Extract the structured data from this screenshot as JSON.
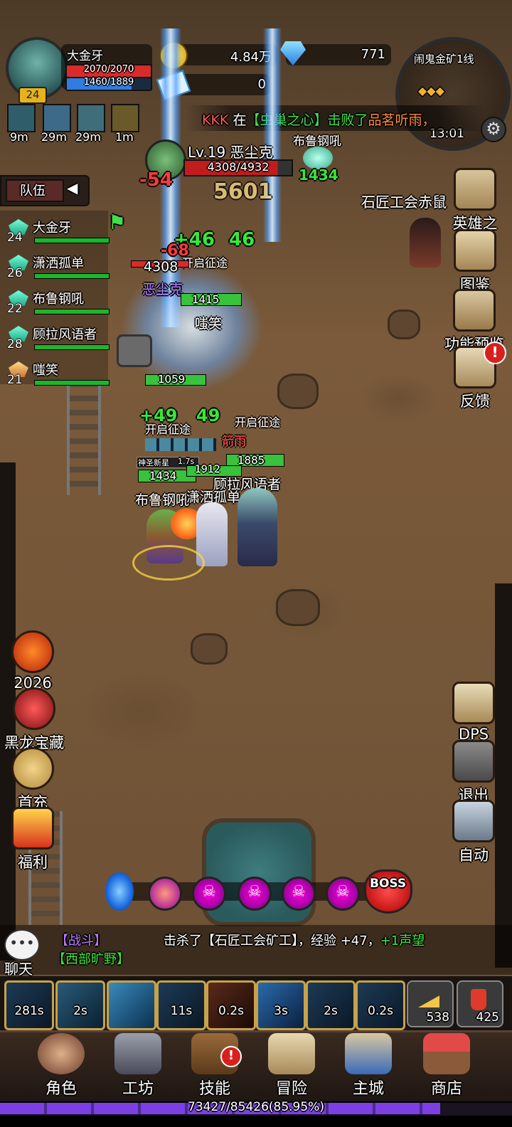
{
  "player": {
    "name": "大金牙",
    "level": "24",
    "hp": "2070/2070",
    "mp": "1460/1889",
    "hp_frac": 1.0,
    "mp_frac": 0.773
  },
  "buffs": [
    "9m",
    "29m",
    "29m",
    "1m"
  ],
  "currency": {
    "gold": "4.84万",
    "diamond": "771",
    "ticket": "0"
  },
  "minimap": {
    "title": "闹鬼金矿1线",
    "time": "13:01"
  },
  "broadcast": {
    "player": "KKK",
    "at": "在",
    "place": "【虫巢之心】",
    "action": "击败了",
    "target": "品茗听雨，"
  },
  "team_label": "队伍",
  "party": [
    {
      "level": "24",
      "name": "大金牙"
    },
    {
      "level": "26",
      "name": "潇洒孤单"
    },
    {
      "level": "22",
      "name": "布鲁钢吼"
    },
    {
      "level": "28",
      "name": "顾拉风语者"
    },
    {
      "level": "21",
      "name": "嗤笑"
    }
  ],
  "boss_target": {
    "label": "Lv.19 恶尘克",
    "hp": "4308/4932",
    "hp_frac": 0.873
  },
  "battle_labels": {
    "ally_top": "布鲁钢吼",
    "ally_top_hp": "1434",
    "guild_enemy": "石匠工会赤鼠",
    "enemy_name": "恶尘克",
    "enemy_hp_text": "4308",
    "chixiao": "嗤笑",
    "chixiao_hp": "1415",
    "hp_1059": "1059",
    "journey": "开启征途",
    "journey2": "开启征途",
    "journey3": "开启征途",
    "rain": "箭雨",
    "holy_star": "神圣新星",
    "holy_time": "1.7s",
    "hp_1885": "1885",
    "hp_1434": "1434",
    "hp_1912": "1912",
    "name_bulu": "布鲁钢吼",
    "name_xiao": "潇洒孤单",
    "name_gula": "顾拉风语者"
  },
  "floats": {
    "dmg1": "-54",
    "heal_top": "5601",
    "heal_plus": "+46",
    "heal_plus2": "46",
    "dmg2": "-68",
    "heal3": "+49",
    "heal4": "49"
  },
  "right_menu": [
    {
      "label": "英雄之路"
    },
    {
      "label": "图鉴"
    },
    {
      "label": "功能预览"
    },
    {
      "label": "反馈"
    }
  ],
  "left_menu": [
    {
      "label": "2026"
    },
    {
      "label": "黑龙宝藏"
    },
    {
      "label": "首充"
    },
    {
      "label": "福利"
    }
  ],
  "right_actions": [
    {
      "label": "DPS"
    },
    {
      "label": "退出"
    },
    {
      "label": "自动"
    }
  ],
  "stage_boss": "BOSS",
  "chat": {
    "label": "聊天",
    "channel1": "【战斗】",
    "channel2": "【西部旷野】",
    "log_prefix": "击杀了【石匠工会矿工】，经验 +47，",
    "log_bonus": "+1声望"
  },
  "skills": [
    "281s",
    "2s",
    "",
    "11s",
    "0.2s",
    "3s",
    "2s",
    "0.2s"
  ],
  "consumables": [
    {
      "count": "538"
    },
    {
      "count": "425"
    }
  ],
  "nav": [
    "角色",
    "工坊",
    "技能",
    "冒险",
    "主城",
    "商店"
  ],
  "exp": {
    "text": "73427/85426(85.95%)",
    "frac": 0.8595
  },
  "colors": {
    "hp": "#d92b2b",
    "mp": "#2f7de0",
    "heal": "#39e639",
    "damage": "#ff3a3a",
    "exp": "#7b3fe4"
  }
}
